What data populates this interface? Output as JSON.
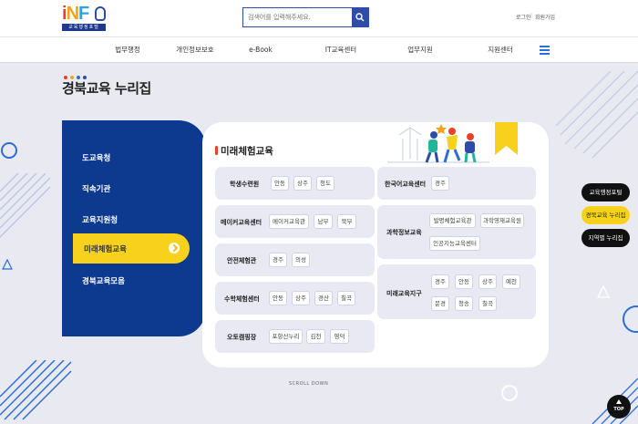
{
  "header": {
    "logo": {
      "word": "iNFO",
      "sub": "교육행정포털"
    },
    "search": {
      "placeholder": "검색어를 입력해주세요."
    },
    "util": {
      "login": "로그인",
      "join": "회원가입",
      "sep": "|"
    }
  },
  "nav": {
    "items": [
      {
        "label": "법무행정"
      },
      {
        "label": "개인정보보호"
      },
      {
        "label": "e-Book"
      },
      {
        "label": "IT교육센터"
      },
      {
        "label": "업무지원"
      },
      {
        "label": "지원센터"
      }
    ]
  },
  "page": {
    "title": "경북교육 누리집"
  },
  "sidebar": {
    "items": [
      {
        "label": "도교육청"
      },
      {
        "label": "직속기관"
      },
      {
        "label": "교육지원청"
      },
      {
        "label": "미래체험교육"
      },
      {
        "label": "경북교육모음"
      }
    ],
    "active_index": 3
  },
  "panel": {
    "title": "미래체험교육",
    "left_rows": [
      {
        "label": "학생수련원",
        "chips": [
          "안동",
          "상주",
          "청도"
        ]
      },
      {
        "label": "메이커교육센터",
        "chips": [
          "메이커교육관",
          "남부",
          "북부"
        ]
      },
      {
        "label": "안전체험관",
        "chips": [
          "경주",
          "의성"
        ]
      },
      {
        "label": "수학체험센터",
        "chips": [
          "안동",
          "상주",
          "경산",
          "칠곡"
        ]
      },
      {
        "label": "오토캠핑장",
        "chips": [
          "포항산누리",
          "김천",
          "영덕"
        ]
      }
    ],
    "right_rows": [
      {
        "label": "한국어교육센터",
        "chips": [
          "경주"
        ]
      },
      {
        "label": "과학정보교육",
        "chips": [
          "발명체험교육관",
          "과학영재교육원",
          "인공지능교육센터"
        ]
      },
      {
        "label": "미래교육지구",
        "chips": [
          "경주",
          "안동",
          "상주",
          "예천",
          "문경",
          "청송",
          "칠곡"
        ]
      }
    ]
  },
  "scroll_hint": "SCROLL DOWN",
  "floating": {
    "buttons": [
      {
        "label": "교육행정포털",
        "bg": "#111111",
        "fg": "#ffffff"
      },
      {
        "label": "경북교육 누리집",
        "bg": "#f7d11c",
        "fg": "#222222"
      },
      {
        "label": "지역별 누리집",
        "bg": "#111111",
        "fg": "#ffffff"
      }
    ],
    "top_label": "TOP"
  },
  "colors": {
    "accent_blue": "#0d3a8f",
    "accent_yellow": "#f7d11c",
    "dots": [
      "#e8412c",
      "#f4a21a",
      "#2c6dd6",
      "#2c4ca8"
    ]
  }
}
